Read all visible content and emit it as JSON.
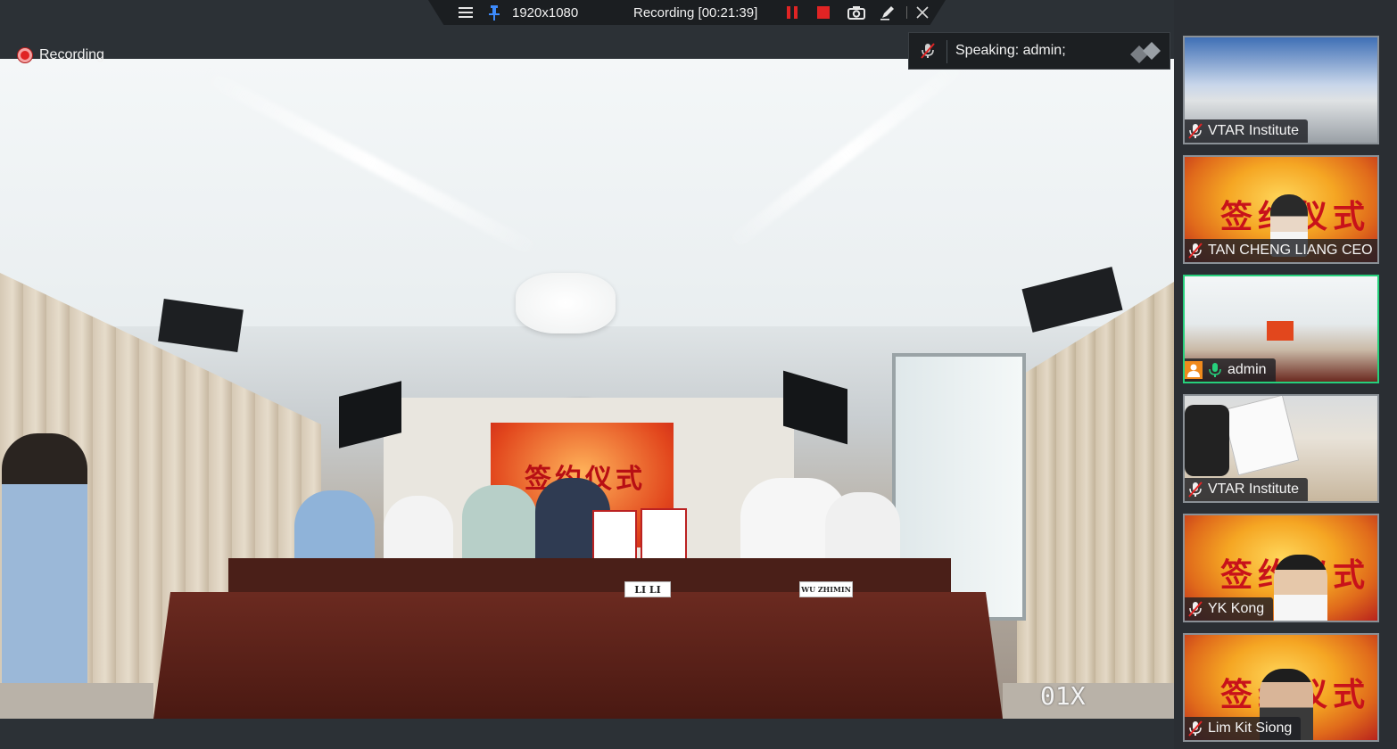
{
  "recording_indicator": {
    "label": "Recording"
  },
  "toolbar": {
    "menu_icon": "hamburger-icon",
    "pin_icon": "pin-icon",
    "resolution": "1920x1080",
    "recording_status": "Recording [00:21:39]",
    "pause_icon": "pause-icon",
    "stop_icon": "stop-icon",
    "camera_icon": "camera-icon",
    "pen_icon": "pen-icon",
    "close_icon": "close-icon"
  },
  "speaking": {
    "label": "Speaking:  admin;"
  },
  "video": {
    "zoom_label": "01X",
    "nameplates": [
      "LI LI",
      "WU ZHIMIN"
    ]
  },
  "participants": [
    {
      "name": "VTAR Institute",
      "mic": "muted",
      "active": false,
      "host": false
    },
    {
      "name": "TAN CHENG LIANG CEO",
      "mic": "muted",
      "active": false,
      "host": false
    },
    {
      "name": "admin",
      "mic": "on",
      "active": true,
      "host": true
    },
    {
      "name": "VTAR Institute",
      "mic": "muted",
      "active": false,
      "host": false
    },
    {
      "name": "YK Kong",
      "mic": "muted",
      "active": false,
      "host": false
    },
    {
      "name": "Lim Kit Siong",
      "mic": "muted",
      "active": false,
      "host": false
    }
  ],
  "colors": {
    "accent_active": "#26d07c",
    "record_red": "#e02424",
    "host_orange": "#f08a1c"
  }
}
